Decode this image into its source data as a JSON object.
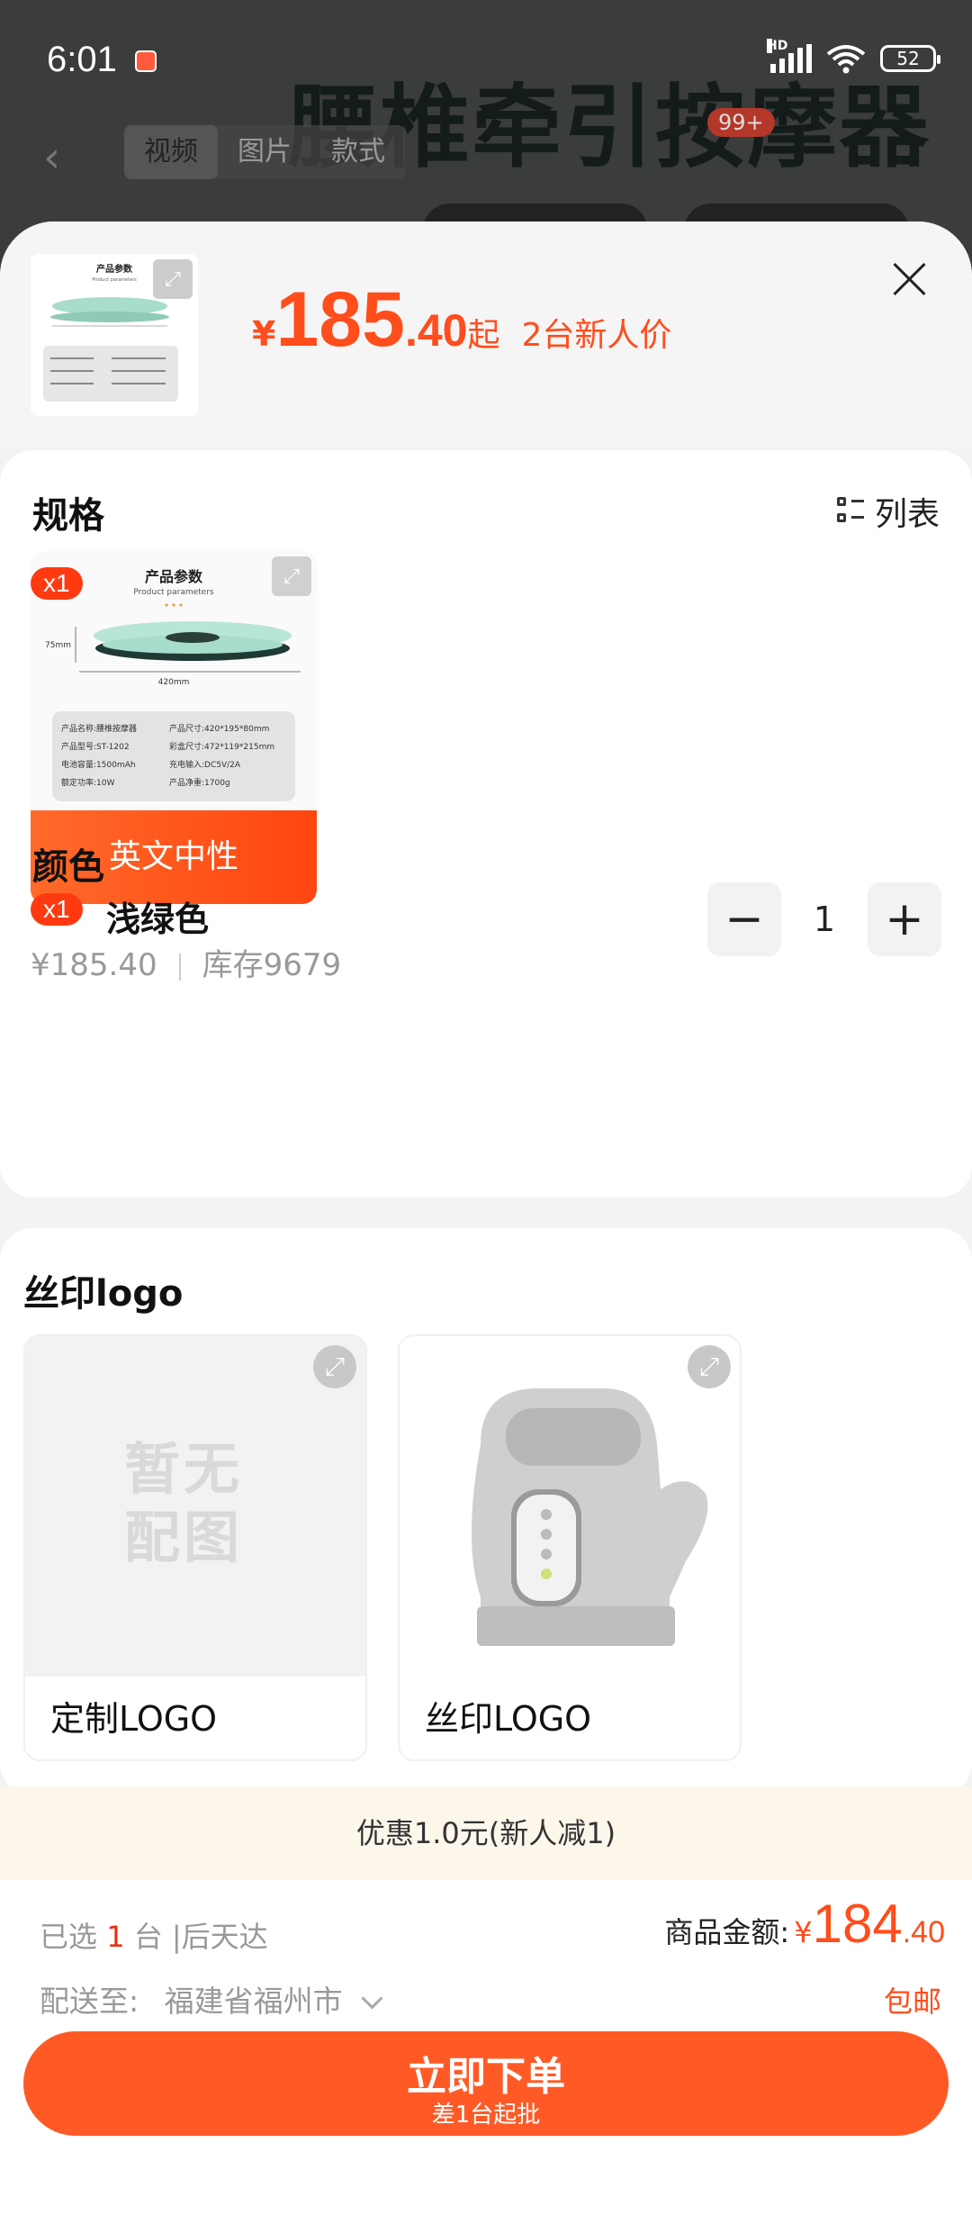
{
  "status_bar": {
    "time": "6:01",
    "network_label": "HD",
    "battery": "52"
  },
  "background": {
    "title": "腰椎牵引按摩器",
    "tabs": [
      "视频",
      "图片",
      "款式"
    ],
    "cart_badge": "99+"
  },
  "header": {
    "price_currency": "¥",
    "price_int": "185",
    "price_dec": ".40",
    "price_suffix": "起",
    "price_tag": "2台新人价",
    "thumb_title": "产品参数",
    "thumb_subtitle": "Product parameters"
  },
  "spec": {
    "title": "规格",
    "list_toggle_label": "列表",
    "option": {
      "label": "英文中性",
      "qty_badge": "x1",
      "img_title": "产品参数",
      "img_subtitle": "Product parameters",
      "dim_height": "75mm",
      "dim_width": "420mm",
      "params": [
        "产品名称:腰椎按摩器",
        "产品尺寸:420*195*80mm",
        "产品型号:ST-1202",
        "彩盒尺寸:472*119*215mm",
        "电池容量:1500mAh",
        "充电输入:DC5V/2A",
        "额定功率:10W",
        "产品净重:1700g"
      ]
    }
  },
  "color": {
    "title": "颜色",
    "qty_badge": "x1",
    "name": "浅绿色",
    "price": "¥185.40",
    "stock": "库存9679",
    "quantity": "1",
    "minus": "−",
    "plus": "+"
  },
  "logo": {
    "title": "丝印logo",
    "items": [
      {
        "name": "定制LOGO",
        "placeholder": "暂无配图"
      },
      {
        "name": "丝印LOGO"
      }
    ]
  },
  "promo": {
    "text": "优惠1.0元(新人减1)"
  },
  "footer": {
    "selected_prefix": "已选",
    "selected_count": "1",
    "selected_suffix": "台 |后天达",
    "total_label": "商品金额:",
    "total_currency": "¥",
    "total_int": "184",
    "total_dec": ".40",
    "ship_label": "配送至:",
    "ship_location": "福建省福州市",
    "free_shipping": "包邮",
    "order_button": "立即下单",
    "order_sub": "差1台起批"
  },
  "colors": {
    "accent": "#ff4d1c",
    "button": "#ff5a26",
    "promo_bg": "#fdf6ea",
    "mint": "#a8dccc"
  }
}
